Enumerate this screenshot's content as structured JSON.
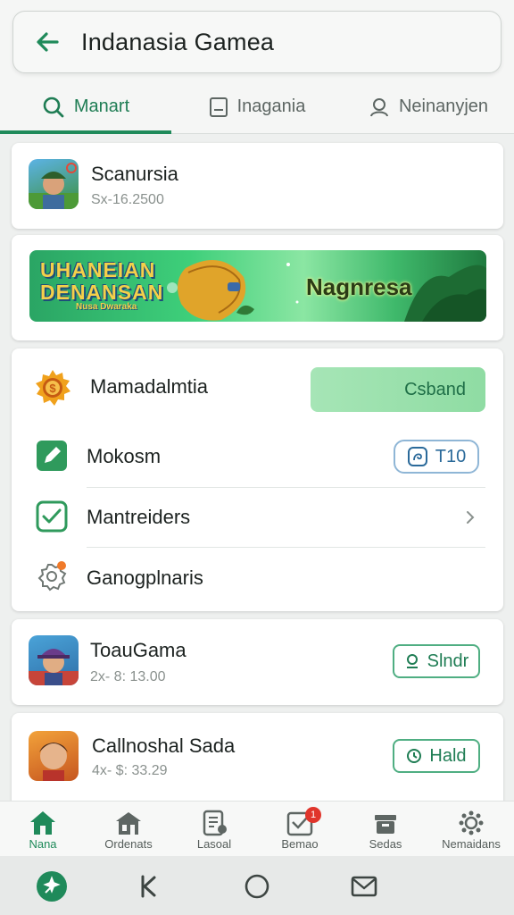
{
  "header": {
    "title": "Indanasia Gamea",
    "back_icon": "arrow-left-icon"
  },
  "tabs": [
    {
      "label": "Manart",
      "icon": "search-icon",
      "active": true
    },
    {
      "label": "Inagania",
      "icon": "square-icon",
      "active": false
    },
    {
      "label": "Neinanyjen",
      "icon": "person-icon",
      "active": false
    }
  ],
  "app1": {
    "title": "Scanursia",
    "subtitle": "Sx-16.2500"
  },
  "banner": {
    "left_line1": "UHANEIAN",
    "left_line2": "DENANSAN",
    "left_small": "Nusa Dwaraka",
    "right_text": "Nagnresa"
  },
  "menu": {
    "row1": {
      "label": "Mamadalmtia",
      "button": "Csband",
      "icon": "coin-gear-icon"
    },
    "row2": {
      "label": "Mokosm",
      "button": "T10",
      "icon": "pencil-square-icon"
    },
    "row3": {
      "label": "Mantreiders",
      "icon": "checkbox-icon"
    },
    "row4": {
      "label": "Ganogplnaris",
      "icon": "badge-person-icon"
    }
  },
  "app2": {
    "title": "ToauGama",
    "subtitle": "2x- 8: 13.00",
    "button": "Slndr"
  },
  "app3": {
    "title": "Callnoshal Sada",
    "subtitle": "4x- $: 33.29",
    "button": "Hald"
  },
  "nav": [
    {
      "label": "Nana",
      "icon": "home-icon",
      "active": true
    },
    {
      "label": "Ordenats",
      "icon": "store-icon"
    },
    {
      "label": "Lasoal",
      "icon": "document-icon"
    },
    {
      "label": "Bemao",
      "icon": "checklist-icon",
      "badge": "1"
    },
    {
      "label": "Sedas",
      "icon": "box-icon"
    },
    {
      "label": "Nemaidans",
      "icon": "settings-icon"
    }
  ],
  "colors": {
    "accent": "#1f8a5a",
    "badge": "#e0352b"
  }
}
